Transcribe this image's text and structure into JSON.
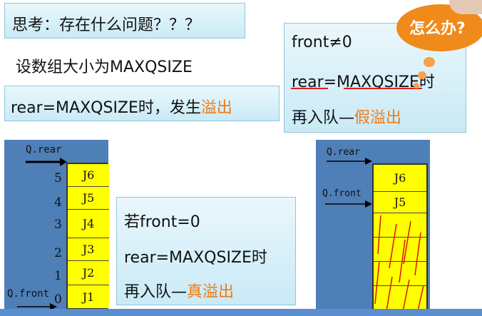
{
  "top_left_box": {
    "text": "思考：存在什么问题？？？"
  },
  "intro_line": "设数组大小为MAXQSIZE",
  "overflow_box": {
    "prefix": "rear=MAXQSIZE时，发生",
    "highlight": "溢出"
  },
  "right_top_box": {
    "line1": "front≠0",
    "line2": "rear=MAXQSIZE时",
    "line3_prefix": "再入队—",
    "line3_highlight": "假溢出"
  },
  "bubble": {
    "label": "怎么办?"
  },
  "middle_box": {
    "line1": "若front=0",
    "line2": "rear=MAXQSIZE时",
    "line3_prefix": "再入队—",
    "line3_highlight": "真溢出"
  },
  "left_diagram": {
    "rear_label": "Q.rear",
    "front_label": "Q.front",
    "indices": [
      "5",
      "4",
      "3",
      "2",
      "1",
      "0"
    ],
    "cells": [
      "J6",
      "J5",
      "J4",
      "J3",
      "J2",
      "J1"
    ]
  },
  "right_diagram": {
    "rear_label": "Q.rear",
    "front_label": "Q.front",
    "cells": [
      "J6",
      "J5",
      "",
      "",
      "",
      ""
    ]
  },
  "colors": {
    "accent": "#f07a10",
    "panel": "#4f7fb7",
    "cell": "#ffff00",
    "box": "#d9f0f9"
  }
}
